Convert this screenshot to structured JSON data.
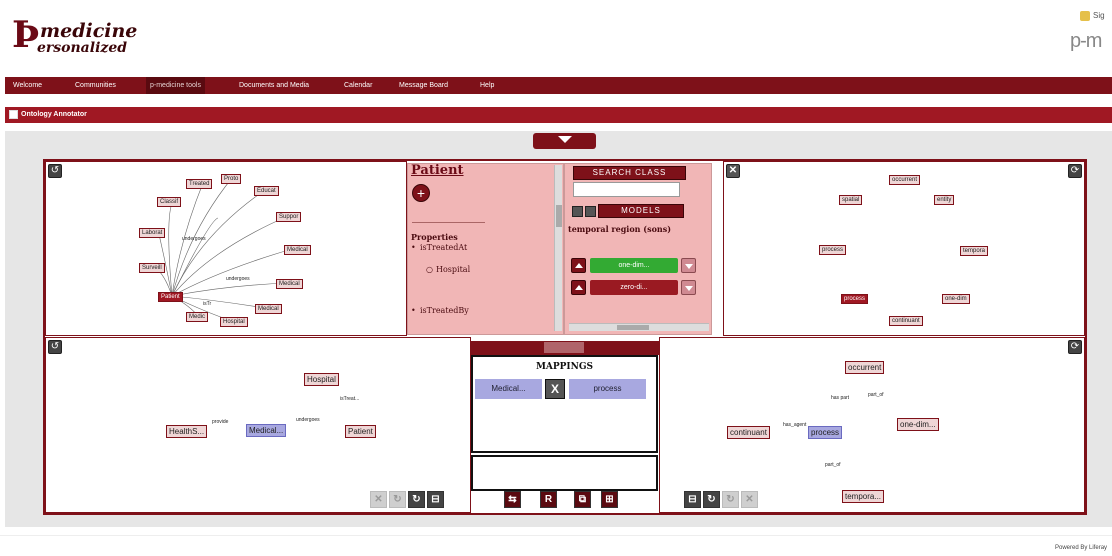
{
  "header": {
    "logo": {
      "line1": "medicine",
      "line2": "ersonalized"
    },
    "top_right_link": "Sig",
    "top_right_brand": "p-m"
  },
  "nav": {
    "items": [
      "Welcome",
      "Communities",
      "p-medicine tools",
      "Documents and Media",
      "Calendar",
      "Message Board",
      "Help"
    ],
    "active_index": 2
  },
  "section": {
    "title": "Ontology Annotator"
  },
  "patient_panel": {
    "title": "Patient",
    "properties_label": "Properties",
    "items": [
      "isTreatedAt",
      "Hospital",
      "isTreatedBy"
    ]
  },
  "search_panel": {
    "search_label": "SEARCH CLASS",
    "search_value": "",
    "models_label": "MODELS",
    "temporal_label": "temporal region (sons)",
    "class_buttons": [
      {
        "label": "one-dim...",
        "color": "#33aa33"
      },
      {
        "label": "zero-di...",
        "color": "#9a1a22"
      }
    ]
  },
  "mappings": {
    "title": "MAPPINGS",
    "left": "Medical...",
    "right": "process"
  },
  "graph_left_bottom": {
    "nodes": [
      "Hospital",
      "HealthS...",
      "Medical...",
      "Patient"
    ],
    "edges": [
      "isTreat...",
      "provide",
      "undergoes"
    ]
  },
  "graph_right_bottom": {
    "nodes": [
      "occurrent",
      "continuant",
      "process",
      "one-dim...",
      "tempora..."
    ],
    "edges": [
      "has part",
      "has_agent",
      "part_of",
      "part_of"
    ]
  },
  "footer": {
    "text": "Powered By Liferay"
  },
  "colors": {
    "brand": "#7e1119",
    "section": "#a01823",
    "pink": "#f1b6b6",
    "mapping_blue": "#a8a8e0"
  }
}
